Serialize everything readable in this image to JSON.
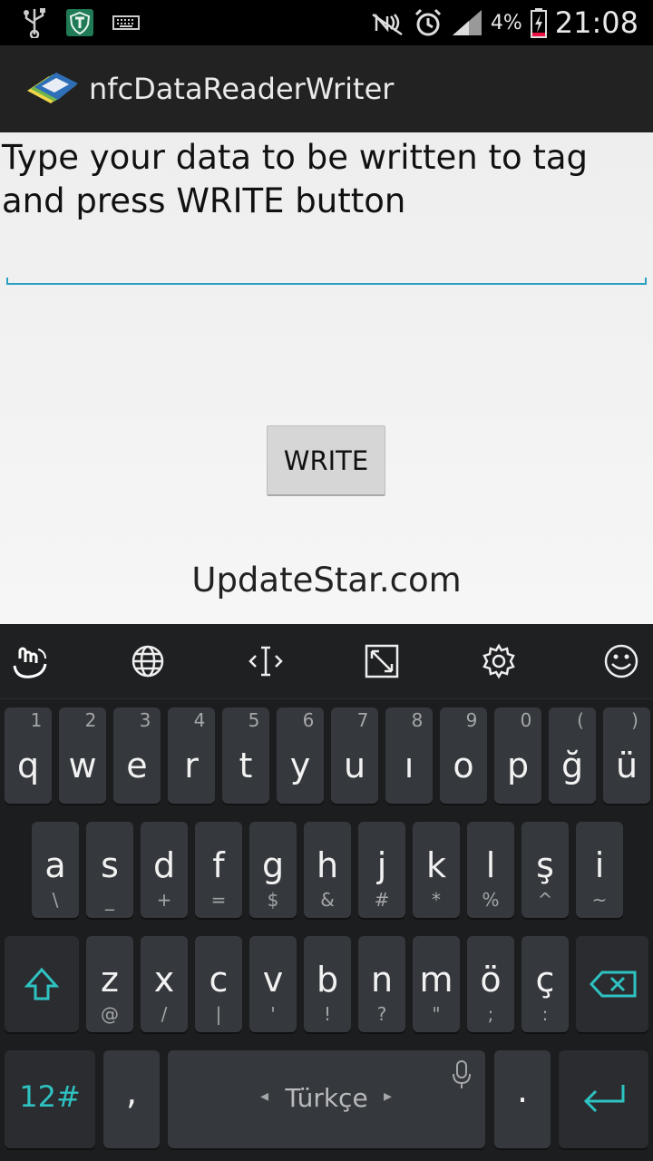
{
  "status": {
    "battery": "4%",
    "time": "21:08"
  },
  "app": {
    "title": "nfcDataReaderWriter"
  },
  "main": {
    "prompt": "Type your data to be written to tag and press WRITE button",
    "input_value": "",
    "write_label": "WRITE",
    "watermark": "UpdateStar.com"
  },
  "keyboard": {
    "row1": [
      {
        "main": "q",
        "sec": "1"
      },
      {
        "main": "w",
        "sec": "2"
      },
      {
        "main": "e",
        "sec": "3"
      },
      {
        "main": "r",
        "sec": "4"
      },
      {
        "main": "t",
        "sec": "5"
      },
      {
        "main": "y",
        "sec": "6"
      },
      {
        "main": "u",
        "sec": "7"
      },
      {
        "main": "ı",
        "sec": "8"
      },
      {
        "main": "o",
        "sec": "9"
      },
      {
        "main": "p",
        "sec": "0"
      },
      {
        "main": "ğ",
        "sec": "("
      },
      {
        "main": "ü",
        "sec": ")"
      }
    ],
    "row2": [
      {
        "main": "a",
        "sec": "\\"
      },
      {
        "main": "s",
        "sec": "_"
      },
      {
        "main": "d",
        "sec": "+"
      },
      {
        "main": "f",
        "sec": "="
      },
      {
        "main": "g",
        "sec": "$"
      },
      {
        "main": "h",
        "sec": "&"
      },
      {
        "main": "j",
        "sec": "#"
      },
      {
        "main": "k",
        "sec": "*"
      },
      {
        "main": "l",
        "sec": "%"
      },
      {
        "main": "ş",
        "sec": "^"
      },
      {
        "main": "i",
        "sec": "~"
      }
    ],
    "row3": [
      {
        "main": "z",
        "sec": "@"
      },
      {
        "main": "x",
        "sec": "/"
      },
      {
        "main": "c",
        "sec": "|"
      },
      {
        "main": "v",
        "sec": "'"
      },
      {
        "main": "b",
        "sec": "!"
      },
      {
        "main": "n",
        "sec": "?"
      },
      {
        "main": "m",
        "sec": "\""
      },
      {
        "main": "ö",
        "sec": ";"
      },
      {
        "main": "ç",
        "sec": ":"
      }
    ],
    "numbers_label": "12#",
    "comma_label": ",",
    "space_label": "Türkçe",
    "period_label": "."
  },
  "colors": {
    "accent": "#2aa0c2",
    "keyboard_teal": "#2fc2c2"
  }
}
